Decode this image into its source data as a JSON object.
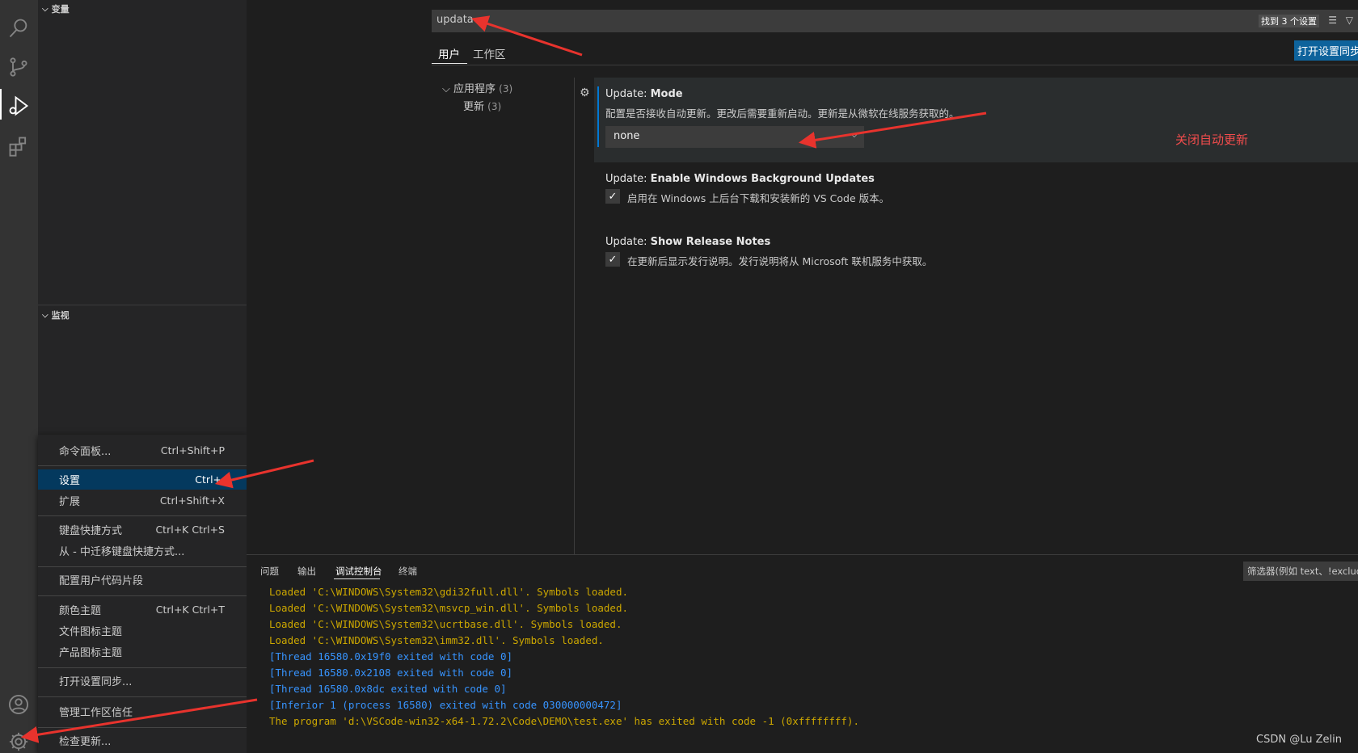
{
  "sidebar": {
    "variables_header": "变量",
    "watch_header": "监视"
  },
  "menu": {
    "items": [
      {
        "label": "命令面板...",
        "key": "Ctrl+Shift+P"
      },
      {
        "label": "设置",
        "key": "Ctrl+,"
      },
      {
        "label": "扩展",
        "key": "Ctrl+Shift+X"
      },
      {
        "label": "键盘快捷方式",
        "key": "Ctrl+K Ctrl+S"
      },
      {
        "label": "从 - 中迁移键盘快捷方式...",
        "key": ""
      },
      {
        "label": "配置用户代码片段",
        "key": ""
      },
      {
        "label": "颜色主题",
        "key": "Ctrl+K Ctrl+T"
      },
      {
        "label": "文件图标主题",
        "key": ""
      },
      {
        "label": "产品图标主题",
        "key": ""
      },
      {
        "label": "打开设置同步...",
        "key": ""
      },
      {
        "label": "管理工作区信任",
        "key": ""
      },
      {
        "label": "检查更新...",
        "key": ""
      }
    ]
  },
  "settings": {
    "search_value": "updata",
    "result_count": "找到 3 个设置",
    "tabs": [
      "用户",
      "工作区"
    ],
    "sync_button": "打开设置同步",
    "toc": [
      {
        "label": "应用程序",
        "count": "(3)"
      },
      {
        "label": "更新",
        "count": "(3)"
      }
    ],
    "items": [
      {
        "category": "Update:",
        "name": "Mode",
        "description": "配置是否接收自动更新。更改后需要重新启动。更新是从微软在线服务获取的。",
        "value": "none"
      },
      {
        "category": "Update:",
        "name": "Enable Windows Background Updates",
        "description": "启用在 Windows 上后台下载和安装新的 VS Code 版本。",
        "checked": "✓"
      },
      {
        "category": "Update:",
        "name": "Show Release Notes",
        "description": "在更新后显示发行说明。发行说明将从 Microsoft 联机服务中获取。",
        "checked": "✓"
      }
    ],
    "annotation": "关闭自动更新"
  },
  "panel": {
    "tabs": [
      "问题",
      "输出",
      "调试控制台",
      "终端"
    ],
    "filter_placeholder": "筛选器(例如 text、!exclude)",
    "console_lines": [
      "Loaded 'C:\\WINDOWS\\System32\\gdi32full.dll'. Symbols loaded.",
      "Loaded 'C:\\WINDOWS\\System32\\msvcp_win.dll'. Symbols loaded.",
      "Loaded 'C:\\WINDOWS\\System32\\ucrtbase.dll'. Symbols loaded.",
      "Loaded 'C:\\WINDOWS\\System32\\imm32.dll'. Symbols loaded.",
      "[Thread 16580.0x19f0 exited with code 0]",
      "[Thread 16580.0x2108 exited with code 0]",
      "[Thread 16580.0x8dc exited with code 0]",
      "[Inferior 1 (process 16580) exited with code 030000000472]",
      "The program 'd:\\VSCode-win32-x64-1.72.2\\Code\\DEMO\\test.exe' has exited with code -1 (0xffffffff)."
    ]
  },
  "credit": "CSDN @Lu Zelin",
  "colors": {
    "accent": "#0e639c",
    "selection": "#04395e",
    "warning_text": "#cca700",
    "info_text": "#3794ff",
    "annotation": "#f14c4c"
  }
}
